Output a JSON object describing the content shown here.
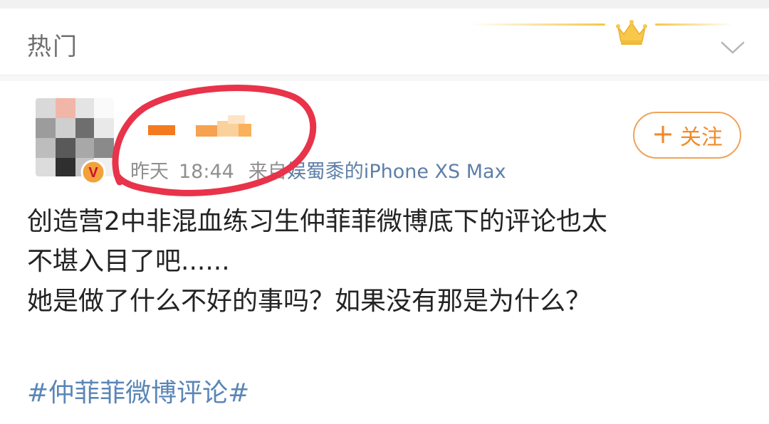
{
  "header": {
    "tab_title": "热门",
    "crown_color": "#f7c84a",
    "expand_icon": "chevron-down-icon"
  },
  "post": {
    "author": {
      "name_visible": false,
      "verified_badge": "V",
      "verified_color": "#e8952a"
    },
    "meta": {
      "date": "昨天",
      "time": "18:44",
      "source_label": "来自",
      "source_device": "娱蜀黍的iPhone XS Max"
    },
    "follow_button": {
      "plus": "+",
      "label": "关注"
    },
    "content_lines": [
      "创造营2中非混血练习生仲菲菲微博底下的评论也太",
      "不堪入目了吧......",
      "她是做了什么不好的事吗？如果没有那是为什么？"
    ],
    "hashtag": "#仲菲菲微博评论#"
  },
  "annotation": {
    "ellipse_color": "#e8334a"
  }
}
